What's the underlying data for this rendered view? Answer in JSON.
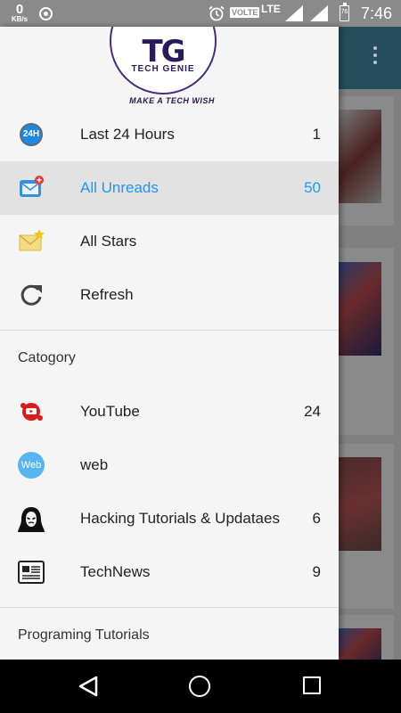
{
  "status_bar": {
    "speed_value": "0",
    "speed_unit": "KB/s",
    "volte": "VOLTE",
    "network": "LTE",
    "battery": "76",
    "time": "7:46"
  },
  "logo": {
    "monogram": "TG",
    "name": "TECH GENIE",
    "tagline": "MAKE A TECH WISH"
  },
  "menu": {
    "items": [
      {
        "label": "Last 24 Hours",
        "count": "1",
        "icon": "24h-icon"
      },
      {
        "label": "All Unreads",
        "count": "50",
        "icon": "unread-mail-icon"
      },
      {
        "label": "All Stars",
        "count": "",
        "icon": "starred-mail-icon"
      },
      {
        "label": "Refresh",
        "count": "",
        "icon": "refresh-icon"
      }
    ]
  },
  "category": {
    "title": "Catogory",
    "items": [
      {
        "label": "YouTube",
        "count": "24",
        "icon": "youtube-icon"
      },
      {
        "label": "web",
        "count": "",
        "icon": "web-icon",
        "icon_text": "Web"
      },
      {
        "label": "Hacking Tutorials & Updataes",
        "count": "6",
        "icon": "hacker-mask-icon"
      },
      {
        "label": "TechNews",
        "count": "9",
        "icon": "newspaper-icon"
      }
    ]
  },
  "programming": {
    "title": "Programing Tutorials"
  },
  "colors": {
    "active_accent": "#2196f3",
    "drawer_bg": "#f5f5f5",
    "active_row_bg": "#e2e2e2",
    "toolbar_bg": "#254d5d"
  }
}
